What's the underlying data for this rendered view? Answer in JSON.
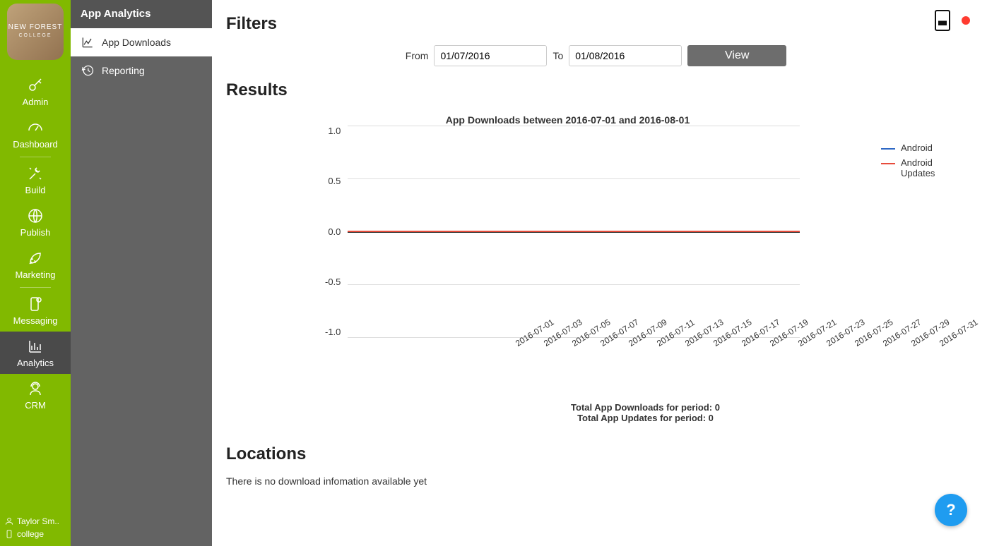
{
  "brand": {
    "line1": "NEW FOREST",
    "line2": "COLLEGE"
  },
  "rail": {
    "items": [
      {
        "key": "admin",
        "label": "Admin"
      },
      {
        "key": "dashboard",
        "label": "Dashboard"
      },
      {
        "key": "build",
        "label": "Build"
      },
      {
        "key": "publish",
        "label": "Publish"
      },
      {
        "key": "marketing",
        "label": "Marketing"
      },
      {
        "key": "messaging",
        "label": "Messaging"
      },
      {
        "key": "analytics",
        "label": "Analytics"
      },
      {
        "key": "crm",
        "label": "CRM"
      }
    ],
    "active": "analytics",
    "footer_user": "Taylor Sm..",
    "footer_org": "college"
  },
  "subnav": {
    "title": "App Analytics",
    "items": [
      {
        "key": "downloads",
        "label": "App Downloads"
      },
      {
        "key": "reporting",
        "label": "Reporting"
      }
    ],
    "active": "downloads"
  },
  "filters": {
    "heading": "Filters",
    "from_label": "From",
    "to_label": "To",
    "from_value": "01/07/2016",
    "to_value": "01/08/2016",
    "view_label": "View"
  },
  "results_heading": "Results",
  "chart_data": {
    "type": "line",
    "title": "App Downloads between 2016-07-01 and 2016-08-01",
    "ylim": [
      -1.0,
      1.0
    ],
    "yticks": [
      1.0,
      0.5,
      0.0,
      -0.5,
      -1.0
    ],
    "xlabel": "",
    "ylabel": "",
    "x": [
      "2016-07-01",
      "2016-07-02",
      "2016-07-03",
      "2016-07-04",
      "2016-07-05",
      "2016-07-06",
      "2016-07-07",
      "2016-07-08",
      "2016-07-09",
      "2016-07-10",
      "2016-07-11",
      "2016-07-12",
      "2016-07-13",
      "2016-07-14",
      "2016-07-15",
      "2016-07-16",
      "2016-07-17",
      "2016-07-18",
      "2016-07-19",
      "2016-07-20",
      "2016-07-21",
      "2016-07-22",
      "2016-07-23",
      "2016-07-24",
      "2016-07-25",
      "2016-07-26",
      "2016-07-27",
      "2016-07-28",
      "2016-07-29",
      "2016-07-30",
      "2016-07-31"
    ],
    "x_tick_labels": [
      "2016-07-01",
      "2016-07-03",
      "2016-07-05",
      "2016-07-07",
      "2016-07-09",
      "2016-07-11",
      "2016-07-13",
      "2016-07-15",
      "2016-07-17",
      "2016-07-19",
      "2016-07-21",
      "2016-07-23",
      "2016-07-25",
      "2016-07-27",
      "2016-07-29",
      "2016-07-31"
    ],
    "series": [
      {
        "name": "Android",
        "color": "#2e68c5",
        "values": [
          0,
          0,
          0,
          0,
          0,
          0,
          0,
          0,
          0,
          0,
          0,
          0,
          0,
          0,
          0,
          0,
          0,
          0,
          0,
          0,
          0,
          0,
          0,
          0,
          0,
          0,
          0,
          0,
          0,
          0,
          0
        ]
      },
      {
        "name": "Android Updates",
        "color": "#e74c3c",
        "values": [
          0,
          0,
          0,
          0,
          0,
          0,
          0,
          0,
          0,
          0,
          0,
          0,
          0,
          0,
          0,
          0,
          0,
          0,
          0,
          0,
          0,
          0,
          0,
          0,
          0,
          0,
          0,
          0,
          0,
          0,
          0
        ]
      }
    ],
    "totals": {
      "downloads_text": "Total App Downloads for period: 0",
      "updates_text": "Total App Updates for period: 0"
    }
  },
  "locations": {
    "heading": "Locations",
    "empty_text": "There is no download infomation available yet"
  },
  "help_label": "?"
}
